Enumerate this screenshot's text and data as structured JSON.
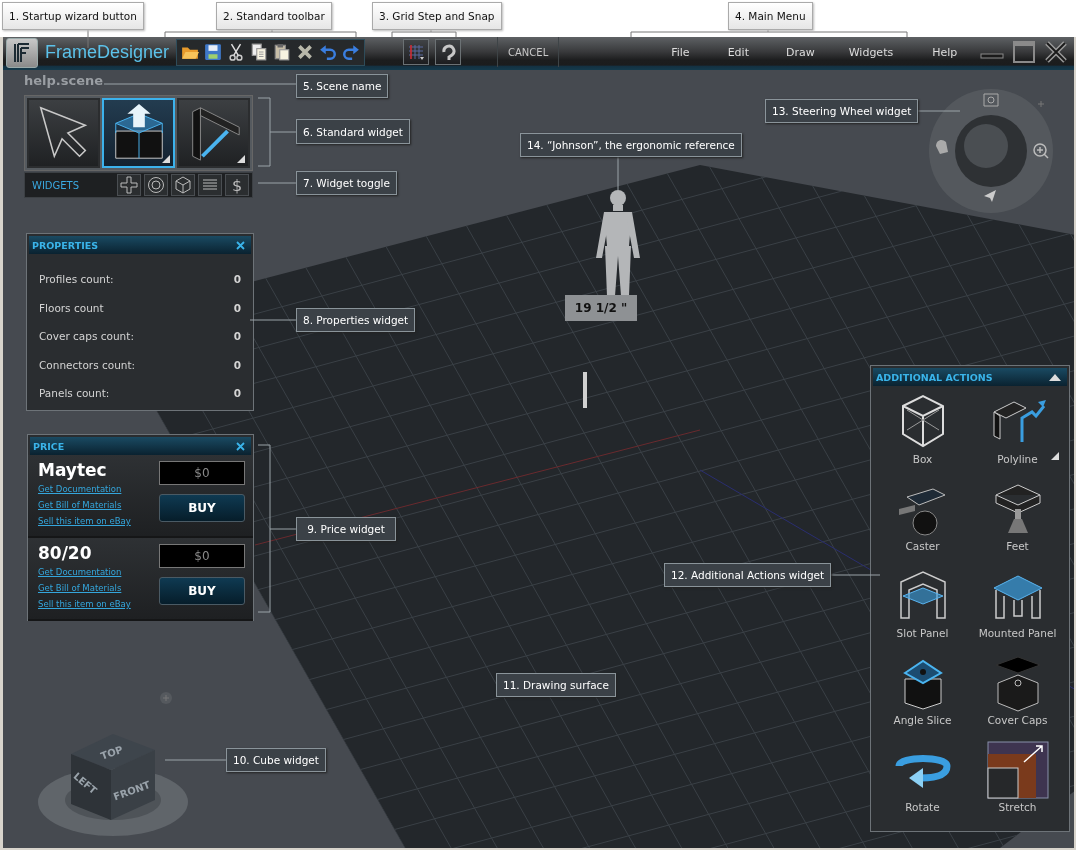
{
  "annotations": [
    {
      "label": "1. Startup wizard button"
    },
    {
      "label": "2. Standard toolbar"
    },
    {
      "label": "3. Grid Step and Snap"
    },
    {
      "label": "4. Main Menu"
    },
    {
      "label": "5. Scene name"
    },
    {
      "label": "6. Standard widget"
    },
    {
      "label": "7. Widget toggle"
    },
    {
      "label": "8. Properties widget"
    },
    {
      "label": "9. Price widget"
    },
    {
      "label": "10. Cube widget"
    },
    {
      "label": "11. Drawing surface"
    },
    {
      "label": "12. Additional Actions widget"
    },
    {
      "label": "13. Steering Wheel widget"
    },
    {
      "label": "14. “Johnson”, the ergonomic reference"
    }
  ],
  "title_bar": {
    "app_name": "FrameDesigner",
    "toolbar": [
      {
        "kind": "open"
      },
      {
        "kind": "save"
      },
      {
        "kind": "cut"
      },
      {
        "kind": "copy"
      },
      {
        "kind": "paste"
      },
      {
        "kind": "delete"
      },
      {
        "kind": "undo"
      },
      {
        "kind": "redo"
      }
    ],
    "tool_buttons": [
      {
        "kind": "grid"
      },
      {
        "kind": "snap"
      }
    ],
    "cancel": "CANCEL",
    "menu": [
      "File",
      "Edit",
      "Draw",
      "Widgets",
      "Help"
    ]
  },
  "scene_name": "help.scene",
  "standard_widget": {
    "tools": [
      {
        "kind": "pointer",
        "selected": false,
        "flyout": false
      },
      {
        "kind": "extrude",
        "selected": true,
        "flyout": true
      },
      {
        "kind": "profile",
        "selected": false,
        "flyout": true
      }
    ]
  },
  "widget_toggle": {
    "label": "WIDGETS",
    "buttons": [
      {
        "kind": "plus"
      },
      {
        "kind": "wheel"
      },
      {
        "kind": "cube"
      },
      {
        "kind": "list"
      },
      {
        "kind": "dollar",
        "glyph": "$"
      }
    ]
  },
  "properties": {
    "title": "PROPERTIES",
    "rows": [
      {
        "label": "Profiles count:",
        "value": "0"
      },
      {
        "label": "Floors count",
        "value": "0"
      },
      {
        "label": "Cover caps count:",
        "value": "0"
      },
      {
        "label": "Connectors count:",
        "value": "0"
      },
      {
        "label": "Panels count:",
        "value": "0"
      }
    ]
  },
  "price": {
    "title": "PRICE",
    "vendors": [
      {
        "name": "Maytec",
        "price": "$0",
        "links": [
          "Get Documentation",
          "Get Bill of Materials",
          "Sell this item on eBay"
        ],
        "buy": "BUY"
      },
      {
        "name": "80/20",
        "price": "$0",
        "links": [
          "Get Documentation",
          "Get Bill of Materials",
          "Sell this item on eBay"
        ],
        "buy": "BUY"
      }
    ]
  },
  "scene": {
    "dimension": "19 1/2 \""
  },
  "view_cube": {
    "faces": [
      "TOP",
      "LEFT",
      "FRONT"
    ]
  },
  "additional_actions": {
    "title": "ADDITIONAL ACTIONS",
    "items": [
      {
        "kind": "box",
        "label": "Box",
        "flyout": false
      },
      {
        "kind": "polyline",
        "label": "Polyline",
        "flyout": true
      },
      {
        "kind": "caster",
        "label": "Caster",
        "flyout": false
      },
      {
        "kind": "feet",
        "label": "Feet",
        "flyout": false
      },
      {
        "kind": "slot_panel",
        "label": "Slot Panel",
        "flyout": false
      },
      {
        "kind": "mounted_panel",
        "label": "Mounted Panel",
        "flyout": false
      },
      {
        "kind": "angle_slice",
        "label": "Angle Slice",
        "flyout": false
      },
      {
        "kind": "cover_caps",
        "label": "Cover Caps",
        "flyout": false
      },
      {
        "kind": "rotate",
        "label": "Rotate",
        "flyout": false
      },
      {
        "kind": "stretch",
        "label": "Stretch",
        "flyout": false
      }
    ]
  }
}
